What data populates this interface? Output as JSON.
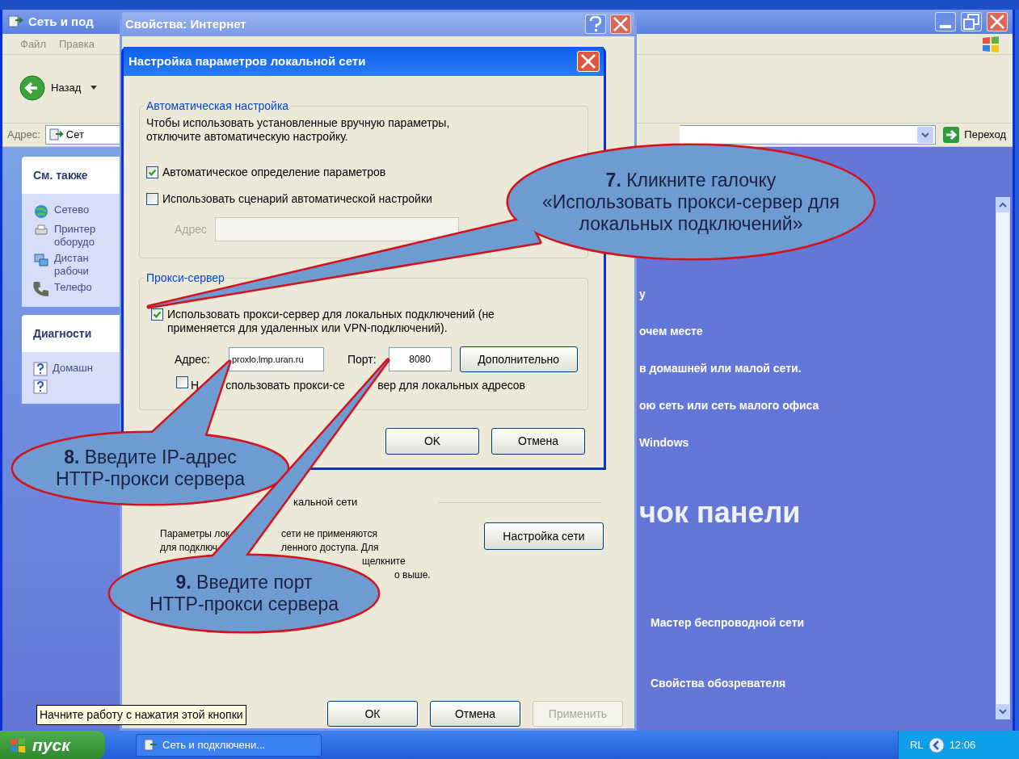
{
  "explorer": {
    "title": "Сеть и под",
    "menu": [
      "Файл",
      "Правка"
    ],
    "back_label": "Назад",
    "address_label": "Адрес:",
    "address_value": "Сет",
    "go_label": "Переход",
    "see_also": {
      "title": "См. также",
      "items": [
        "Сетево",
        "Принтер\nоборудо",
        "Дистан\nрабочи",
        "Телефо"
      ]
    },
    "diagnostics": {
      "title": "Диагности",
      "items": [
        "Домашн"
      ]
    },
    "main": {
      "links": [
        "у",
        "очем месте",
        "в домашней или малой сети.",
        "ою сеть или сеть малого офиса",
        "Windows"
      ],
      "heading": "чок панели",
      "tasks": [
        "Мастер беспроводной сети",
        "Свойства обозревателя"
      ]
    }
  },
  "internet_properties": {
    "title": "Свойства: Интернет",
    "lan_heading": "кальной сети",
    "lan_lines": [
      {
        "left": "Параметры лок",
        "right": "сети не применяются"
      },
      {
        "left": "для подключ",
        "right": "ленного доступа. Для"
      },
      {
        "right": "щелкните"
      },
      {
        "right": "о выше."
      }
    ],
    "lan_settings_button": "Настройка сети",
    "buttons": [
      {
        "label": "ОК",
        "disabled": false
      },
      {
        "label": "Отмена",
        "disabled": false
      },
      {
        "label": "Применить",
        "disabled": true
      }
    ]
  },
  "lan_dialog": {
    "title": "Настройка параметров локальной сети",
    "auto": {
      "legend": "Автоматическая настройка",
      "description": "Чтобы использовать установленные вручную параметры,\nотключите автоматическую настройку.",
      "options": [
        {
          "label": "Автоматическое определение параметров",
          "checked": true
        },
        {
          "label": "Использовать сценарий автоматической настройки",
          "checked": false
        }
      ],
      "address": {
        "label": "Адрес",
        "disabled": true
      }
    },
    "proxy": {
      "legend": "Прокси-сервер",
      "use_proxy": {
        "label": "Использовать прокси-сервер для локальных подключений (не\nприменяется для удаленных или VPN-подключений).",
        "checked": true
      },
      "address_label": "Адрес:",
      "address_value": "proxlo.lmp.uran.ru",
      "port_label": "Порт:",
      "port_value": "8080",
      "advanced_button": "Дополнительно",
      "bypass": {
        "label_parts": [
          "Н",
          "спользовать прокси-се",
          "вер для локальных адресов"
        ],
        "checked": false
      }
    },
    "buttons": [
      "OK",
      "Отмена"
    ]
  },
  "callouts": [
    {
      "text": "**7.** Кликните галочку\n«Использовать прокси-сервер для\nлокальных подключений»"
    },
    {
      "text": "**8.** Введите IP-адрес\nHTTP-прокси сервера"
    },
    {
      "text": "**9.** Введите порт\nHTTP-прокси сервера"
    }
  ],
  "tooltip": "Начните работу с нажатия этой кнопки",
  "taskbar": {
    "start": "пуск",
    "tasks": [
      "Сеть и подключени..."
    ],
    "language": "RL",
    "clock": "12:06"
  }
}
